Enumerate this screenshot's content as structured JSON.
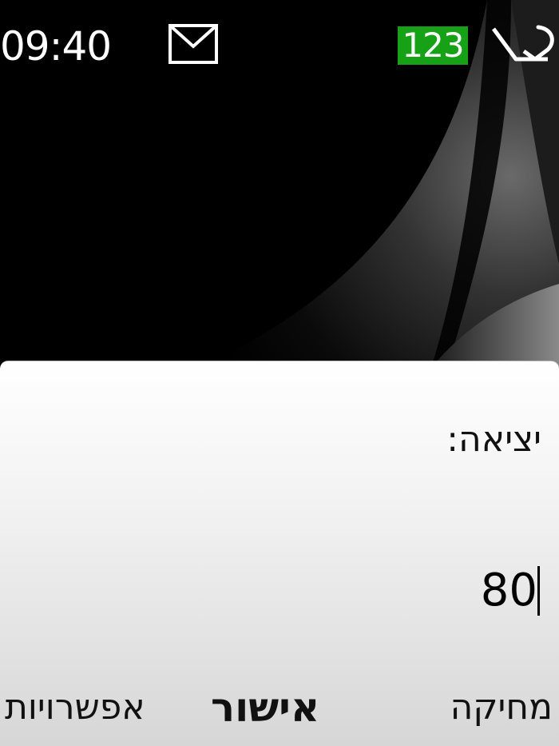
{
  "status_bar": {
    "time": "09:40",
    "input_mode": "123",
    "input_mode_color": "#17a117",
    "icons": [
      "mail-icon",
      "edit-pen-icon"
    ]
  },
  "dialog": {
    "prompt": "יציאה:",
    "value": "80"
  },
  "softkeys": {
    "left": "אפשרויות",
    "middle": "אישור",
    "right": "מחיקה"
  }
}
